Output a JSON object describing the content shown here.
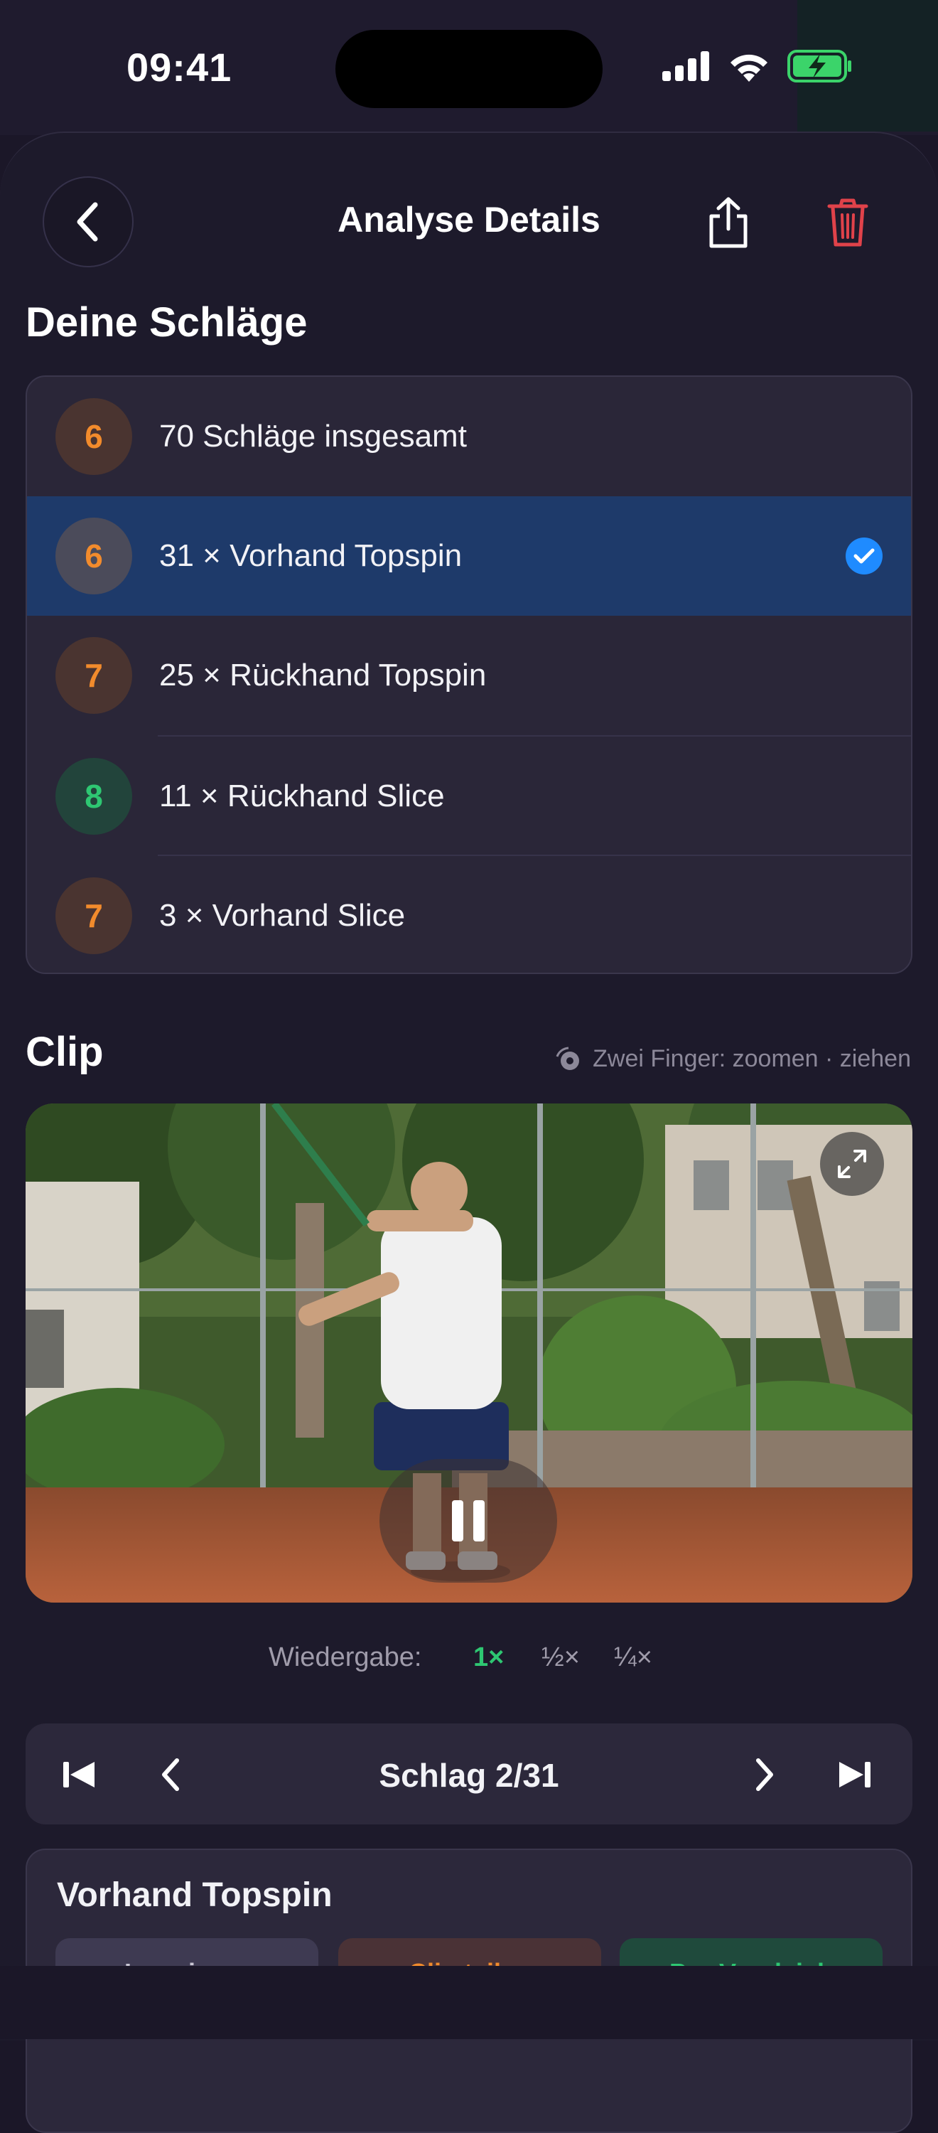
{
  "status": {
    "time": "09:41"
  },
  "header": {
    "title": "Analyse Details"
  },
  "shots": {
    "title": "Deine Schläge",
    "rows": [
      {
        "score": "6",
        "label": "70 Schläge insgesamt",
        "tone": "orange",
        "selected": false
      },
      {
        "score": "6",
        "label": "31 × Vorhand Topspin",
        "tone": "orange",
        "selected": true
      },
      {
        "score": "7",
        "label": "25 × Rückhand Topspin",
        "tone": "orange",
        "selected": false
      },
      {
        "score": "8",
        "label": "11 × Rückhand Slice",
        "tone": "green",
        "selected": false
      },
      {
        "score": "7",
        "label": "3 × Vorhand Slice",
        "tone": "orange",
        "selected": false
      }
    ]
  },
  "clip": {
    "title": "Clip",
    "hint": "Zwei Finger: zoomen · ziehen"
  },
  "playback": {
    "label": "Wiedergabe:",
    "speeds": [
      "1×",
      "½×",
      "¼×"
    ],
    "active": "1×"
  },
  "stepper": {
    "label": "Schlag 2/31"
  },
  "detail": {
    "title": "Vorhand Topspin",
    "actions": [
      "Ignorieren",
      "Clip teilen",
      "Pro Vergleich"
    ]
  },
  "colors": {
    "accent_blue": "#1f8bff",
    "orange": "#f28b2c",
    "green": "#2ec772",
    "delete_red": "#e0424a"
  }
}
